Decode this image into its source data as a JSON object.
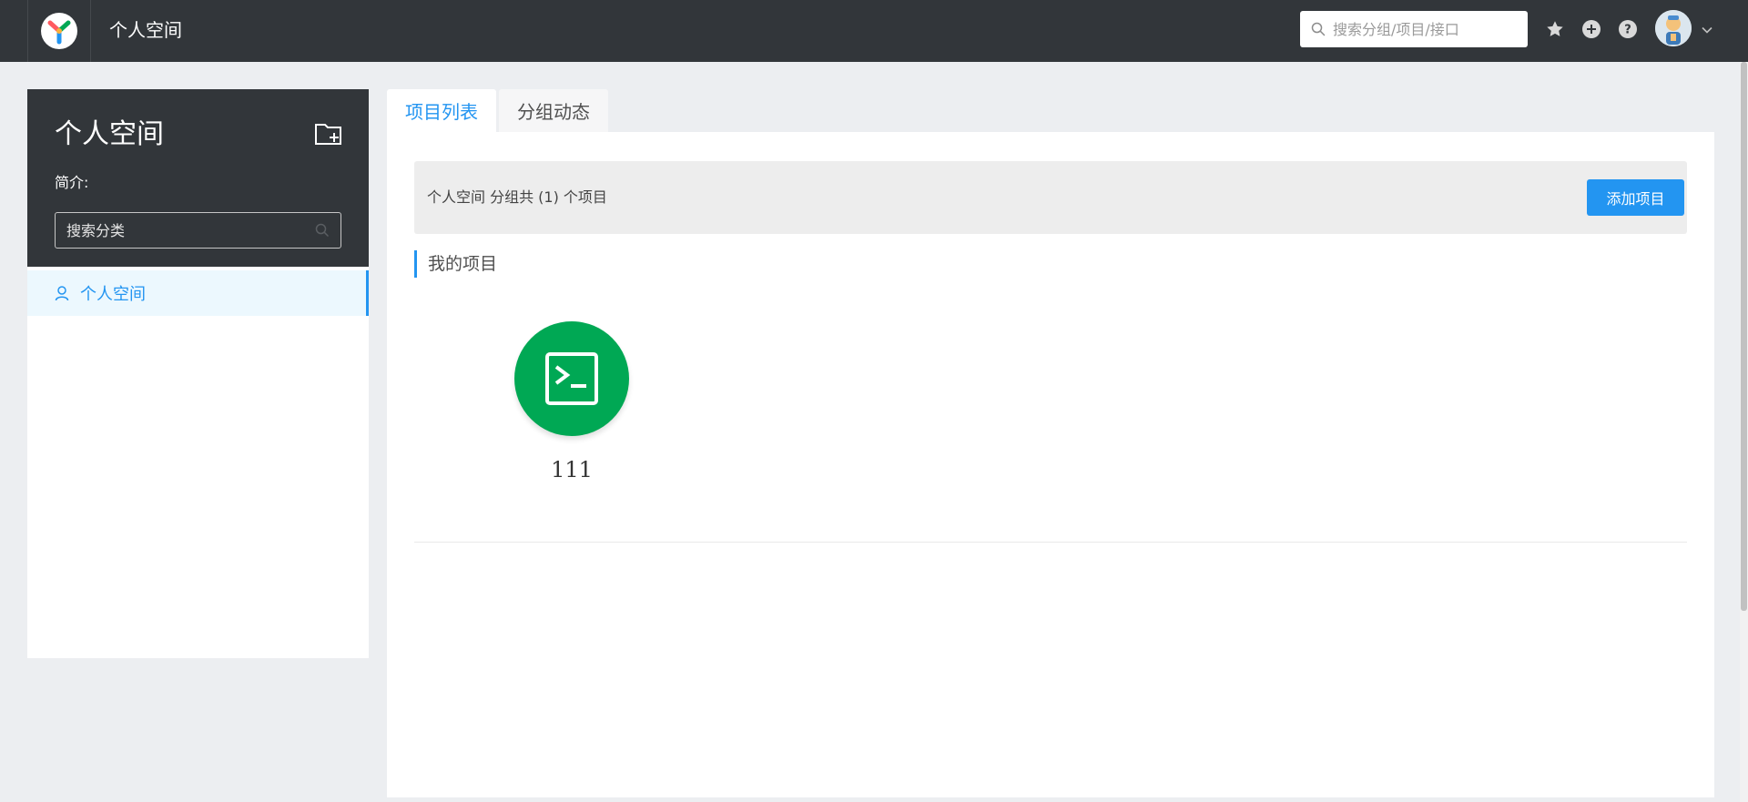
{
  "header": {
    "app_title": "个人空间",
    "search_placeholder": "搜索分组/项目/接口",
    "icons": [
      "logo-icon",
      "star-icon",
      "plus-circle-icon",
      "help-icon",
      "avatar",
      "chevron-down-icon"
    ]
  },
  "sidebar": {
    "group_name": "个人空间",
    "intro_label": "简介:",
    "search_placeholder": "搜索分类",
    "items": [
      {
        "label": "个人空间",
        "icon": "user-icon",
        "selected": true
      }
    ]
  },
  "main": {
    "tabs": [
      {
        "label": "项目列表",
        "active": true
      },
      {
        "label": "分组动态",
        "active": false
      }
    ],
    "summary": "个人空间 分组共 (1) 个项目",
    "add_project_label": "添加项目",
    "section_title": "我的项目",
    "projects": [
      {
        "name": "111",
        "icon": "terminal-icon",
        "color": "#00a854"
      }
    ]
  },
  "colors": {
    "topbar": "#32363a",
    "accent": "#2395f1",
    "project_green": "#00a854",
    "background": "#eceef1"
  }
}
